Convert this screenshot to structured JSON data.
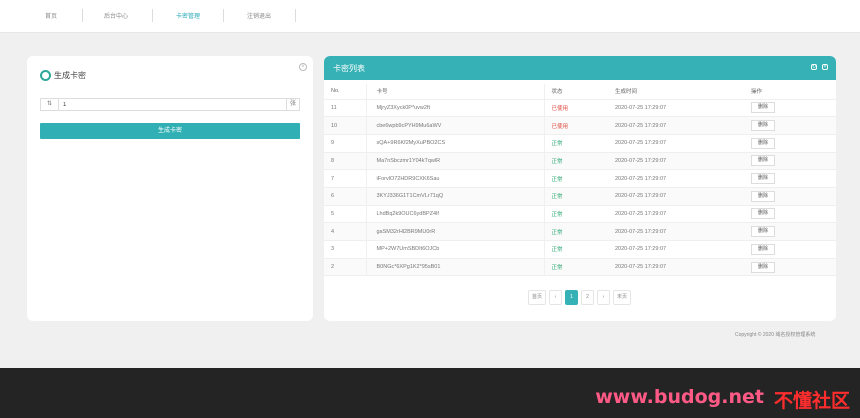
{
  "nav": {
    "items": [
      "首页",
      "后台中心",
      "卡密管理",
      "注销退出"
    ],
    "active_index": 2
  },
  "generate_panel": {
    "title": "生成卡密",
    "quantity_value": "1",
    "sort_icon": "sort-icon",
    "unit": "张",
    "generate_button": "生成卡密",
    "close_icon": "close-circle-icon"
  },
  "list_panel": {
    "title": "卡密列表",
    "icons": [
      "refresh-icon",
      "close-icon"
    ],
    "columns": [
      "No.",
      "卡号",
      "状态",
      "生成时间",
      "操作"
    ],
    "rows": [
      {
        "no": "11",
        "card": "MjryZ3Xyck0P*uvw2ft",
        "status": "已使用",
        "status_type": "used",
        "time": "2020-07-25 17:29:07",
        "action": "删除"
      },
      {
        "no": "10",
        "card": "cbe6wpb9cPYH9Mu6aWV",
        "status": "已使用",
        "status_type": "used",
        "time": "2020-07-25 17:29:07",
        "action": "删除"
      },
      {
        "no": "9",
        "card": "sQA+9R6Kf2MyXuPBO2CS",
        "status": "正常",
        "status_type": "ok",
        "time": "2020-07-25 17:29:07",
        "action": "删除"
      },
      {
        "no": "8",
        "card": "Ma7nSbczmr1Y04kTqwlR",
        "status": "正常",
        "status_type": "ok",
        "time": "2020-07-25 17:29:07",
        "action": "删除"
      },
      {
        "no": "7",
        "card": "iForvlO72HDR9CXK6Sau",
        "status": "正常",
        "status_type": "ok",
        "time": "2020-07-25 17:29:07",
        "action": "删除"
      },
      {
        "no": "6",
        "card": "3KYJ336G1T1CmVLr71qQ",
        "status": "正常",
        "status_type": "ok",
        "time": "2020-07-25 17:29:07",
        "action": "删除"
      },
      {
        "no": "5",
        "card": "LhdBq2k9OUC6ydBPZ4lf",
        "status": "正常",
        "status_type": "ok",
        "time": "2020-07-25 17:29:07",
        "action": "删除"
      },
      {
        "no": "4",
        "card": "gaSM32rHl2BR9MU0rR",
        "status": "正常",
        "status_type": "ok",
        "time": "2020-07-25 17:29:07",
        "action": "删除"
      },
      {
        "no": "3",
        "card": "MP+2W7UmSBDIt6OJCb",
        "status": "正常",
        "status_type": "ok",
        "time": "2020-07-25 17:29:07",
        "action": "删除"
      },
      {
        "no": "2",
        "card": "B0NGc*6XPg1K2*95sB01",
        "status": "正常",
        "status_type": "ok",
        "time": "2020-07-25 17:29:07",
        "action": "删除"
      }
    ],
    "pagination": [
      "首页",
      "‹",
      "1",
      "2",
      "›",
      "末页"
    ],
    "current_page": "1"
  },
  "copyright": "Copyright © 2020 域名授权管理系统",
  "watermark": {
    "url": "www.budog.net",
    "name": "不懂社区"
  },
  "colors": {
    "accent": "#36b2b6",
    "used": "#e0483c",
    "ok": "#2aa871"
  }
}
